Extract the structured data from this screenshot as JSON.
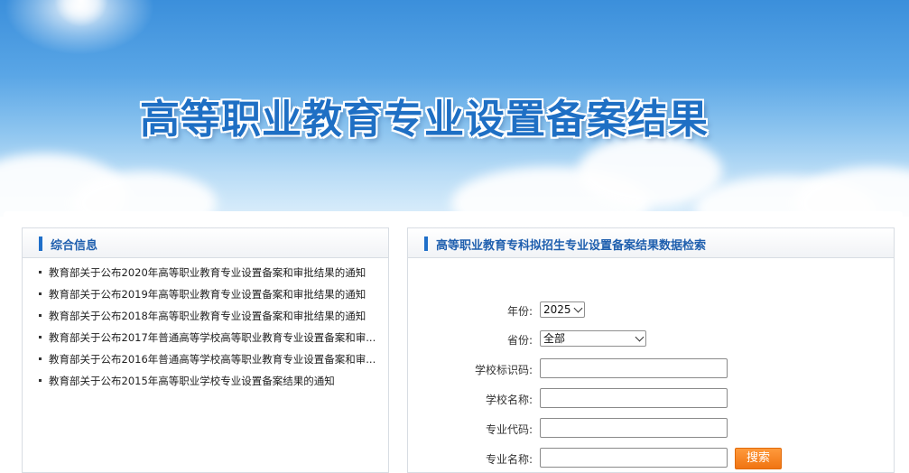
{
  "banner": {
    "title": "高等职业教育专业设置备案结果"
  },
  "left_panel": {
    "title": "综合信息",
    "items": [
      {
        "label": "教育部关于公布2020年高等职业教育专业设置备案和审批结果的通知"
      },
      {
        "label": "教育部关于公布2019年高等职业教育专业设置备案和审批结果的通知"
      },
      {
        "label": "教育部关于公布2018年高等职业教育专业设置备案和审批结果的通知"
      },
      {
        "label": "教育部关于公布2017年普通高等学校高等职业教育专业设置备案和审..."
      },
      {
        "label": "教育部关于公布2016年普通高等学校高等职业教育专业设置备案和审..."
      },
      {
        "label": "教育部关于公布2015年高等职业学校专业设置备案结果的通知"
      }
    ]
  },
  "right_panel": {
    "title": "高等职业教育专科拟招生专业设置备案结果数据检索",
    "form": {
      "year_label": "年份:",
      "year_value": "2025",
      "province_label": "省份:",
      "province_value": "全部",
      "school_id_label": "学校标识码:",
      "school_id_value": "",
      "school_name_label": "学校名称:",
      "school_name_value": "",
      "major_code_label": "专业代码:",
      "major_code_value": "",
      "major_name_label": "专业名称:",
      "major_name_value": "",
      "search_label": "搜索"
    }
  },
  "colors": {
    "accent": "#1f6fc9",
    "title_text": "#1f5fae",
    "button": "#f07412"
  }
}
